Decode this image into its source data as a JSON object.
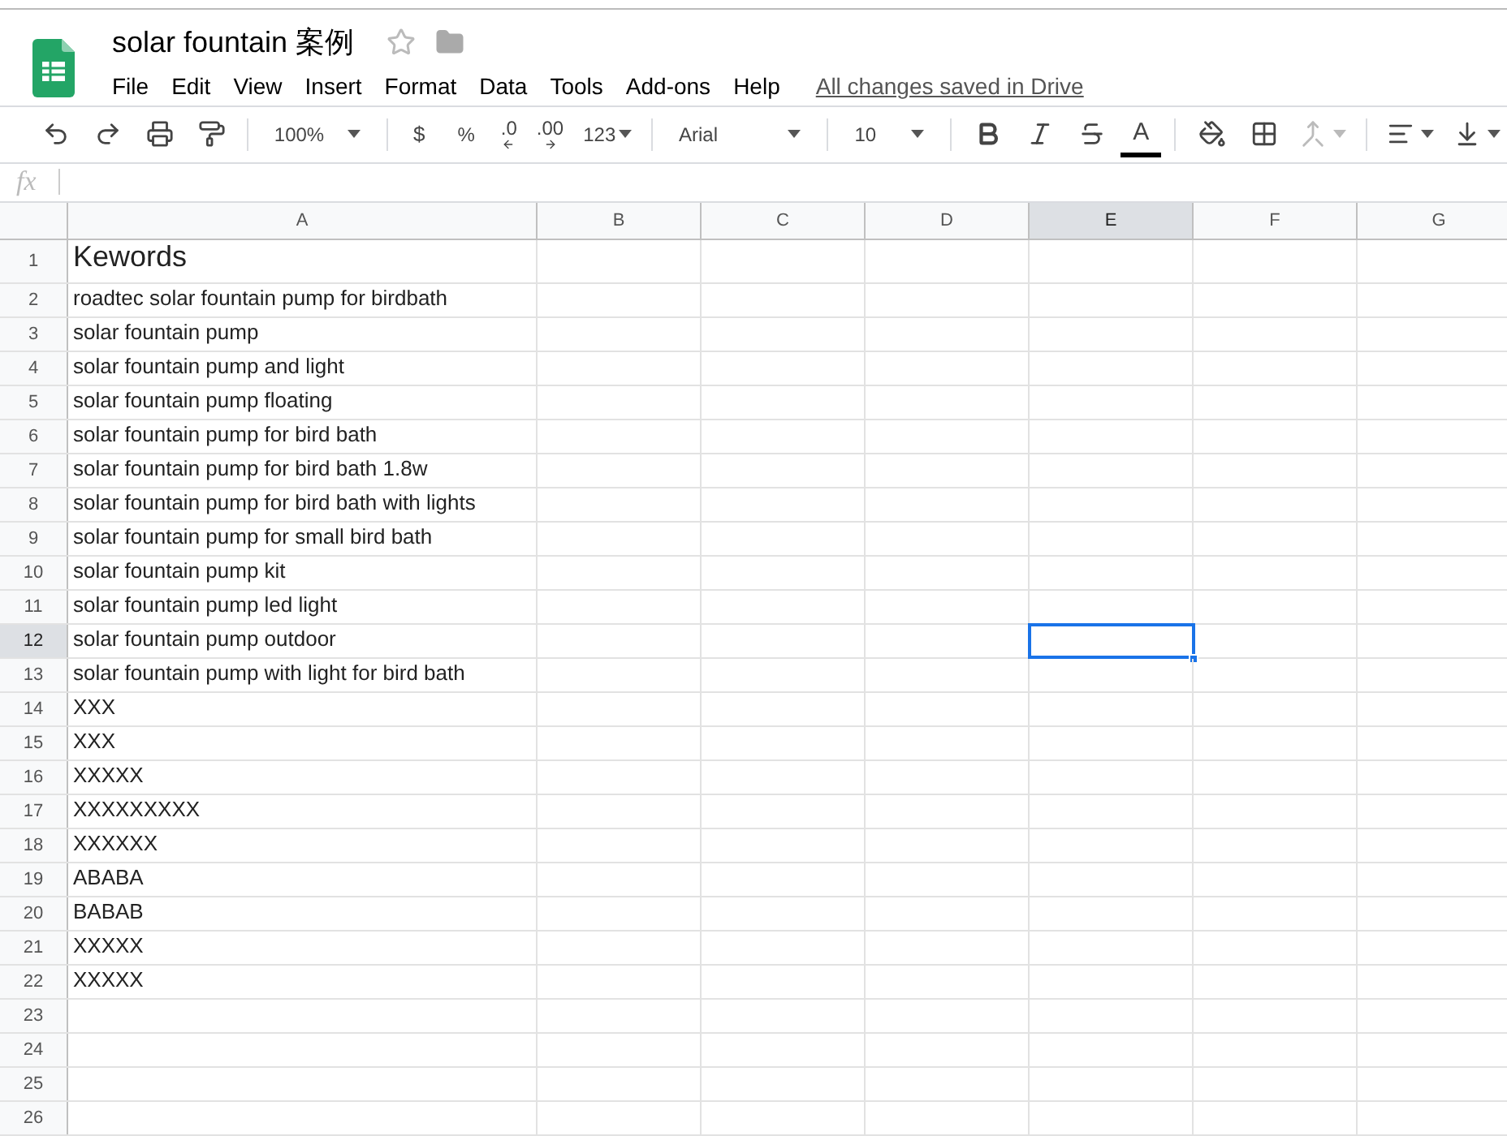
{
  "document": {
    "title": "solar fountain 案例",
    "starred": false,
    "save_status": "All changes saved in Drive"
  },
  "menu": [
    "File",
    "Edit",
    "View",
    "Insert",
    "Format",
    "Data",
    "Tools",
    "Add-ons",
    "Help"
  ],
  "toolbar": {
    "zoom": "100%",
    "currency": "$",
    "percent": "%",
    "decrease_decimals": ".0",
    "increase_decimals": ".00",
    "more_formats": "123",
    "font": "Arial",
    "font_size": "10",
    "text_color": "A",
    "merge_disabled": true
  },
  "formula_bar": {
    "label": "fx"
  },
  "columns": [
    {
      "label": "A",
      "selected": false
    },
    {
      "label": "B",
      "selected": false
    },
    {
      "label": "C",
      "selected": false
    },
    {
      "label": "D",
      "selected": false
    },
    {
      "label": "E",
      "selected": true
    },
    {
      "label": "F",
      "selected": false
    },
    {
      "label": "G",
      "selected": false
    }
  ],
  "rows": [
    {
      "number": "1",
      "kind": "heading",
      "value": "Kewords",
      "selected": false
    },
    {
      "number": "2",
      "kind": "text",
      "value": "roadtec solar fountain pump for birdbath",
      "selected": false
    },
    {
      "number": "3",
      "kind": "text",
      "value": "solar fountain pump",
      "selected": false
    },
    {
      "number": "4",
      "kind": "text",
      "value": "solar fountain pump and light",
      "selected": false
    },
    {
      "number": "5",
      "kind": "text",
      "value": "solar fountain pump floating",
      "selected": false
    },
    {
      "number": "6",
      "kind": "text",
      "value": "solar fountain pump for bird bath",
      "selected": false
    },
    {
      "number": "7",
      "kind": "text",
      "value": "solar fountain pump for bird bath 1.8w",
      "selected": false
    },
    {
      "number": "8",
      "kind": "text",
      "value": "solar fountain pump for bird bath with lights",
      "selected": false
    },
    {
      "number": "9",
      "kind": "text",
      "value": "solar fountain pump for small bird bath",
      "selected": false
    },
    {
      "number": "10",
      "kind": "text",
      "value": "solar fountain pump kit",
      "selected": false
    },
    {
      "number": "11",
      "kind": "text",
      "value": "solar fountain pump led light",
      "selected": false
    },
    {
      "number": "12",
      "kind": "text",
      "value": "solar fountain pump outdoor",
      "selected": true
    },
    {
      "number": "13",
      "kind": "text",
      "value": "solar fountain pump with light for bird bath",
      "selected": false
    },
    {
      "number": "14",
      "kind": "text",
      "value": "XXX",
      "selected": false
    },
    {
      "number": "15",
      "kind": "text",
      "value": "XXX",
      "selected": false
    },
    {
      "number": "16",
      "kind": "text",
      "value": "XXXXX",
      "selected": false
    },
    {
      "number": "17",
      "kind": "text",
      "value": "XXXXXXXXX",
      "selected": false
    },
    {
      "number": "18",
      "kind": "text",
      "value": "XXXXXX",
      "selected": false
    },
    {
      "number": "19",
      "kind": "text",
      "value": "ABABA",
      "selected": false
    },
    {
      "number": "20",
      "kind": "text",
      "value": "BABAB",
      "selected": false
    },
    {
      "number": "21",
      "kind": "text",
      "value": "XXXXX",
      "selected": false
    },
    {
      "number": "22",
      "kind": "text",
      "value": "XXXXX",
      "selected": false
    },
    {
      "number": "23",
      "kind": "text",
      "value": "",
      "selected": false
    },
    {
      "number": "24",
      "kind": "text",
      "value": "",
      "selected": false
    },
    {
      "number": "25",
      "kind": "text",
      "value": "",
      "selected": false
    },
    {
      "number": "26",
      "kind": "text",
      "value": "",
      "selected": false
    }
  ]
}
